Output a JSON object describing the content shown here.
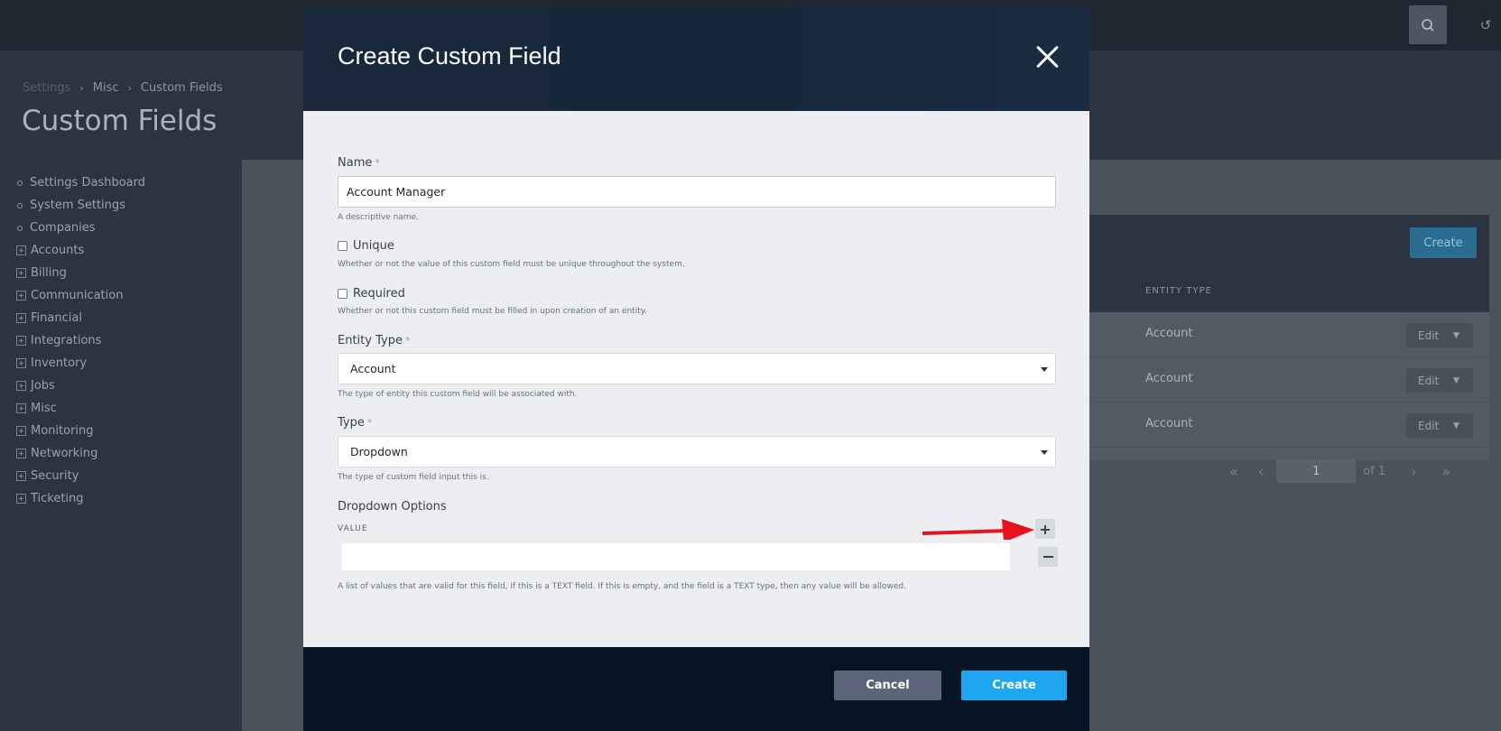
{
  "app": {
    "breadcrumb": [
      "Settings",
      "Misc",
      "Custom Fields"
    ],
    "page_title": "Custom Fields"
  },
  "sidebar": {
    "items": [
      {
        "label": "Settings Dashboard",
        "kind": "bullet"
      },
      {
        "label": "System Settings",
        "kind": "bullet"
      },
      {
        "label": "Companies",
        "kind": "bullet"
      },
      {
        "label": "Accounts",
        "kind": "expand"
      },
      {
        "label": "Billing",
        "kind": "expand"
      },
      {
        "label": "Communication",
        "kind": "expand"
      },
      {
        "label": "Financial",
        "kind": "expand"
      },
      {
        "label": "Integrations",
        "kind": "expand"
      },
      {
        "label": "Inventory",
        "kind": "expand"
      },
      {
        "label": "Jobs",
        "kind": "expand"
      },
      {
        "label": "Misc",
        "kind": "expand"
      },
      {
        "label": "Monitoring",
        "kind": "expand"
      },
      {
        "label": "Networking",
        "kind": "expand"
      },
      {
        "label": "Security",
        "kind": "expand"
      },
      {
        "label": "Ticketing",
        "kind": "expand"
      }
    ]
  },
  "table": {
    "create_label": "Create",
    "column_entity_type": "ENTITY TYPE",
    "rows": [
      {
        "entity_type": "Account",
        "action": "Edit"
      },
      {
        "entity_type": "Account",
        "action": "Edit"
      },
      {
        "entity_type": "Account",
        "action": "Edit"
      }
    ],
    "pager": {
      "page": "1",
      "of": "of 1"
    }
  },
  "modal": {
    "title": "Create Custom Field",
    "name_label": "Name",
    "name_value": "Account Manager",
    "name_help": "A descriptive name.",
    "unique_label": "Unique",
    "unique_help": "Whether or not the value of this custom field must be unique throughout the system.",
    "required_label": "Required",
    "required_help": "Whether or not this custom field must be filled in upon creation of an entity.",
    "entity_type_label": "Entity Type",
    "entity_type_value": "Account",
    "entity_type_help": "The type of entity this custom field will be associated with.",
    "type_label": "Type",
    "type_value": "Dropdown",
    "type_help": "The type of custom field input this is.",
    "options_label": "Dropdown Options",
    "options_column": "VALUE",
    "options_help": "A list of values that are valid for this field, if this is a TEXT field. If this is empty, and the field is a TEXT type, then any value will be allowed.",
    "required_marker": "*",
    "cancel_label": "Cancel",
    "create_label": "Create"
  },
  "colors": {
    "accent": "#1ea7f0",
    "annotation_arrow": "#e8141b",
    "modal_header": "#16273a",
    "modal_footer": "#061423"
  }
}
